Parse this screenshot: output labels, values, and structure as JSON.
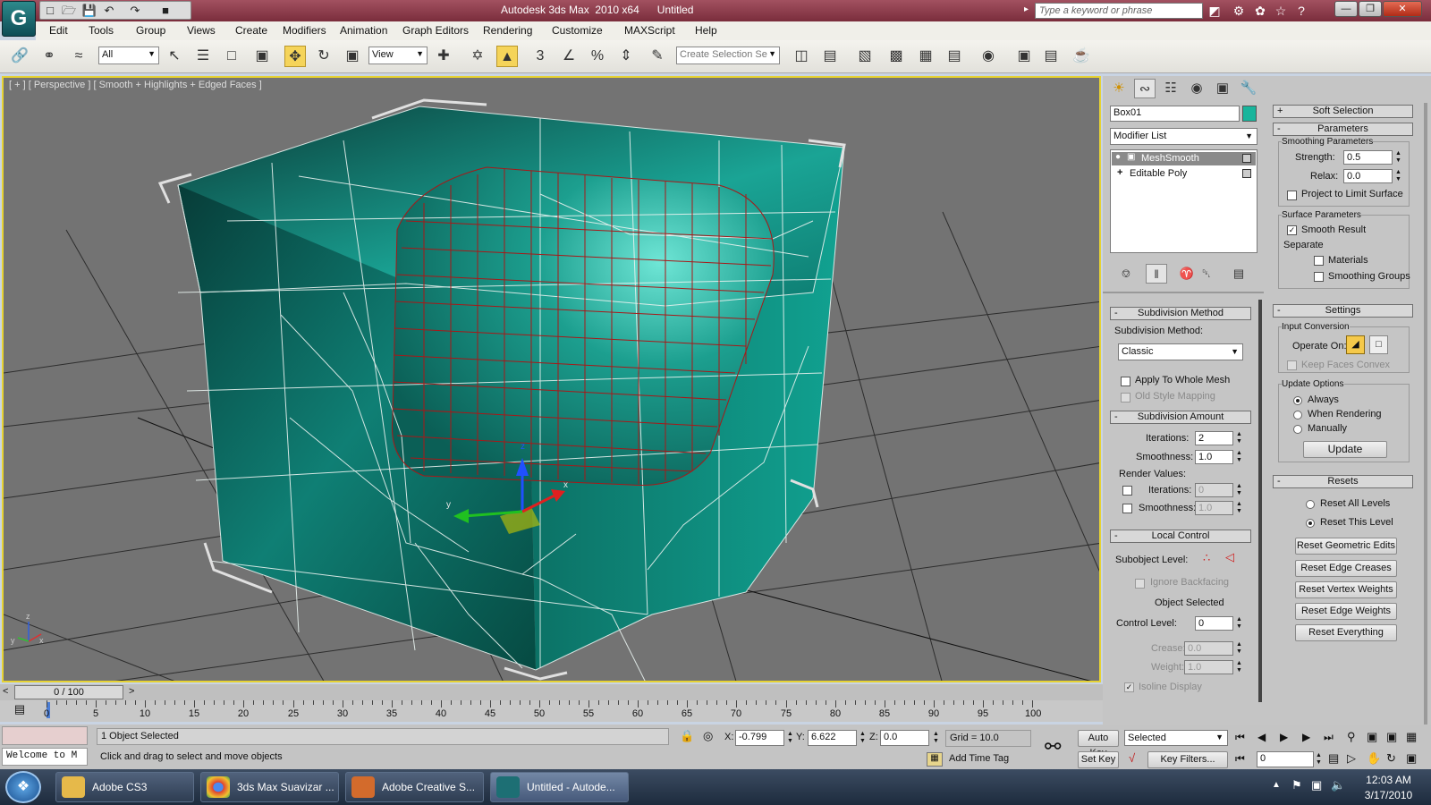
{
  "titlebar": {
    "app": "Autodesk 3ds Max  2010 x64",
    "doc": "Untitled",
    "search_placeholder": "Type a keyword or phrase"
  },
  "menu": [
    "Edit",
    "Tools",
    "Group",
    "Views",
    "Create",
    "Modifiers",
    "Animation",
    "Graph Editors",
    "Rendering",
    "Customize",
    "MAXScript",
    "Help"
  ],
  "toolbar": {
    "filter": "All",
    "refcoord": "View",
    "selset": "Create Selection Se"
  },
  "viewport": {
    "label": "[ + ] [ Perspective ] [ Smooth + Highlights + Edged Faces ]",
    "axes": {
      "x": "x",
      "y": "y",
      "z": "z"
    }
  },
  "colors": {
    "viewport_bg": "#737373",
    "active_border": "#e6d233",
    "object": "#0f8f83",
    "wire": "#ffffff",
    "selected_wire": "#a01010",
    "object_swatch": "#18b59c"
  },
  "panel": {
    "object_name": "Box01",
    "modifier_list": "Modifier List",
    "stack": [
      {
        "name": "MeshSmooth",
        "selected": true
      },
      {
        "name": "Editable Poly",
        "selected": false
      }
    ],
    "subdivision_method": {
      "header": "Subdivision Method",
      "label": "Subdivision Method:",
      "value": "Classic",
      "apply_whole_mesh": "Apply To Whole Mesh",
      "old_style": "Old Style Mapping"
    },
    "subdivision_amount": {
      "header": "Subdivision Amount",
      "iterations_label": "Iterations:",
      "iterations": "2",
      "smoothness_label": "Smoothness:",
      "smoothness": "1.0",
      "render_values": "Render Values:",
      "r_iterations_label": "Iterations:",
      "r_iterations": "0",
      "r_smoothness_label": "Smoothness:",
      "r_smoothness": "1.0"
    },
    "local_control": {
      "header": "Local Control",
      "subobject_label": "Subobject Level:",
      "ignore_backfacing": "Ignore Backfacing",
      "object_selected": "Object Selected",
      "control_level_label": "Control Level:",
      "control_level": "0",
      "crease_label": "Crease:",
      "crease": "0.0",
      "weight_label": "Weight:",
      "weight": "1.0",
      "isoline": "Isoline Display"
    },
    "soft_selection": "Soft Selection",
    "parameters": {
      "header": "Parameters",
      "smoothing_params": "Smoothing Parameters",
      "strength_label": "Strength:",
      "strength": "0.5",
      "relax_label": "Relax:",
      "relax": "0.0",
      "project_limit": "Project to Limit Surface",
      "surface_params": "Surface Parameters",
      "smooth_result": "Smooth Result",
      "separate": "Separate",
      "materials": "Materials",
      "smoothing_groups": "Smoothing Groups"
    },
    "settings": {
      "header": "Settings",
      "input_conversion": "Input Conversion",
      "operate_on": "Operate On:",
      "keep_faces_convex": "Keep Faces Convex",
      "update_options": "Update Options",
      "always": "Always",
      "when_rendering": "When Rendering",
      "manually": "Manually",
      "update": "Update"
    },
    "resets": {
      "header": "Resets",
      "reset_all": "Reset All Levels",
      "reset_this": "Reset This Level",
      "btn1": "Reset Geometric Edits",
      "btn2": "Reset Edge Creases",
      "btn3": "Reset Vertex Weights",
      "btn4": "Reset Edge Weights",
      "btn5": "Reset Everything"
    }
  },
  "timeline": {
    "frame": "0 / 100",
    "ticks": [
      "0",
      "5",
      "10",
      "15",
      "20",
      "25",
      "30",
      "35",
      "40",
      "45",
      "50",
      "55",
      "60",
      "65",
      "70",
      "75",
      "80",
      "85",
      "90",
      "95",
      "100"
    ]
  },
  "status": {
    "maxscript": "Welcome to M",
    "selected": "1 Object Selected",
    "prompt": "Click and drag to select and move objects",
    "x_label": "X:",
    "x": "-0.799",
    "y_label": "Y:",
    "y": "6.622",
    "z_label": "Z:",
    "z": "0.0",
    "grid": "Grid = 10.0",
    "add_time_tag": "Add Time Tag",
    "auto_key": "Auto Key",
    "set_key": "Set Key",
    "key_mode": "Selected",
    "key_filters": "Key Filters...",
    "frame": "0"
  },
  "taskbar": {
    "items": [
      "Adobe CS3",
      "3ds Max Suavizar ...",
      "Adobe Creative S...",
      "Untitled - Autode..."
    ],
    "time": "12:03 AM",
    "date": "3/17/2010"
  }
}
